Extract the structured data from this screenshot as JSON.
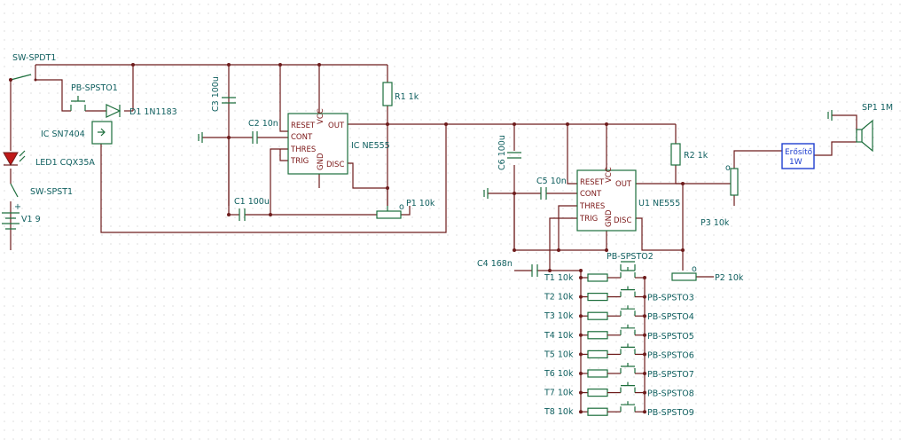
{
  "labels": {
    "sw_spdt1": "SW-SPDT1",
    "pb_spsto1": "PB-SPSTO1",
    "d1": "D1 1N1183",
    "ic_sn7404": "IC SN7404",
    "led1": "LED1 CQX35A",
    "sw_spst1": "SW-SPST1",
    "v1": "V1 9",
    "c3": "C3 100u",
    "c2": "C2 10n",
    "c1": "C1 100u",
    "r1": "R1 1k",
    "p1": "P1 10k",
    "ic_ne555": "IC NE555",
    "c6": "C6 100u",
    "c5": "C5 10n",
    "c4": "C4 168n",
    "u1_ne555": "U1 NE555",
    "r2": "R2 1k",
    "p3": "P3 10k",
    "p2": "P2 10k",
    "pb_spsto2": "PB-SPSTO2",
    "amp_line1": "Erősítő",
    "amp_line2": "1W",
    "sp1": "SP1 1M",
    "plus": "+",
    "pot_marker": "o"
  },
  "ne555_pins": {
    "reset": "RESET",
    "vcc": "VCC",
    "out": "OUT",
    "cont": "CONT",
    "thres": "THRES",
    "trig": "TRIG",
    "gnd": "GND",
    "disc": "DISC"
  },
  "key_rows": [
    {
      "resistor": "T1 10k",
      "button": ""
    },
    {
      "resistor": "T2 10k",
      "button": "PB-SPSTO3"
    },
    {
      "resistor": "T3 10k",
      "button": "PB-SPSTO4"
    },
    {
      "resistor": "T4 10k",
      "button": "PB-SPSTO5"
    },
    {
      "resistor": "T5 10k",
      "button": "PB-SPSTO6"
    },
    {
      "resistor": "T6 10k",
      "button": "PB-SPSTO7"
    },
    {
      "resistor": "T7 10k",
      "button": "PB-SPSTO8"
    },
    {
      "resistor": "T8 10k",
      "button": "PB-SPSTO9"
    }
  ],
  "colors": {
    "wire": "#6e1c1c",
    "component": "#1c6e3c",
    "label": "#0f5f5f",
    "amplifier": "#1e3fd0",
    "led": "#c01818",
    "grid_dot": "#c8c8c8"
  }
}
